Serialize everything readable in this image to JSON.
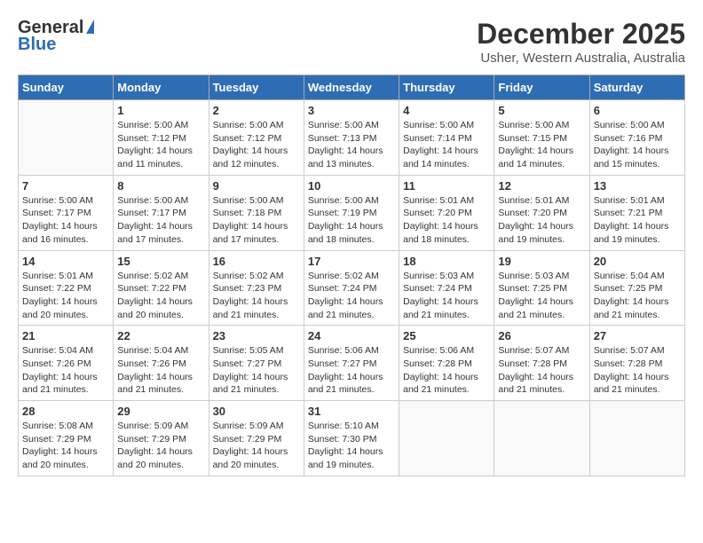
{
  "logo": {
    "general": "General",
    "blue": "Blue"
  },
  "title": "December 2025",
  "subtitle": "Usher, Western Australia, Australia",
  "days_of_week": [
    "Sunday",
    "Monday",
    "Tuesday",
    "Wednesday",
    "Thursday",
    "Friday",
    "Saturday"
  ],
  "weeks": [
    [
      {
        "day": "",
        "info": ""
      },
      {
        "day": "1",
        "info": "Sunrise: 5:00 AM\nSunset: 7:12 PM\nDaylight: 14 hours\nand 11 minutes."
      },
      {
        "day": "2",
        "info": "Sunrise: 5:00 AM\nSunset: 7:12 PM\nDaylight: 14 hours\nand 12 minutes."
      },
      {
        "day": "3",
        "info": "Sunrise: 5:00 AM\nSunset: 7:13 PM\nDaylight: 14 hours\nand 13 minutes."
      },
      {
        "day": "4",
        "info": "Sunrise: 5:00 AM\nSunset: 7:14 PM\nDaylight: 14 hours\nand 14 minutes."
      },
      {
        "day": "5",
        "info": "Sunrise: 5:00 AM\nSunset: 7:15 PM\nDaylight: 14 hours\nand 14 minutes."
      },
      {
        "day": "6",
        "info": "Sunrise: 5:00 AM\nSunset: 7:16 PM\nDaylight: 14 hours\nand 15 minutes."
      }
    ],
    [
      {
        "day": "7",
        "info": "Sunrise: 5:00 AM\nSunset: 7:17 PM\nDaylight: 14 hours\nand 16 minutes."
      },
      {
        "day": "8",
        "info": "Sunrise: 5:00 AM\nSunset: 7:17 PM\nDaylight: 14 hours\nand 17 minutes."
      },
      {
        "day": "9",
        "info": "Sunrise: 5:00 AM\nSunset: 7:18 PM\nDaylight: 14 hours\nand 17 minutes."
      },
      {
        "day": "10",
        "info": "Sunrise: 5:00 AM\nSunset: 7:19 PM\nDaylight: 14 hours\nand 18 minutes."
      },
      {
        "day": "11",
        "info": "Sunrise: 5:01 AM\nSunset: 7:20 PM\nDaylight: 14 hours\nand 18 minutes."
      },
      {
        "day": "12",
        "info": "Sunrise: 5:01 AM\nSunset: 7:20 PM\nDaylight: 14 hours\nand 19 minutes."
      },
      {
        "day": "13",
        "info": "Sunrise: 5:01 AM\nSunset: 7:21 PM\nDaylight: 14 hours\nand 19 minutes."
      }
    ],
    [
      {
        "day": "14",
        "info": "Sunrise: 5:01 AM\nSunset: 7:22 PM\nDaylight: 14 hours\nand 20 minutes."
      },
      {
        "day": "15",
        "info": "Sunrise: 5:02 AM\nSunset: 7:22 PM\nDaylight: 14 hours\nand 20 minutes."
      },
      {
        "day": "16",
        "info": "Sunrise: 5:02 AM\nSunset: 7:23 PM\nDaylight: 14 hours\nand 21 minutes."
      },
      {
        "day": "17",
        "info": "Sunrise: 5:02 AM\nSunset: 7:24 PM\nDaylight: 14 hours\nand 21 minutes."
      },
      {
        "day": "18",
        "info": "Sunrise: 5:03 AM\nSunset: 7:24 PM\nDaylight: 14 hours\nand 21 minutes."
      },
      {
        "day": "19",
        "info": "Sunrise: 5:03 AM\nSunset: 7:25 PM\nDaylight: 14 hours\nand 21 minutes."
      },
      {
        "day": "20",
        "info": "Sunrise: 5:04 AM\nSunset: 7:25 PM\nDaylight: 14 hours\nand 21 minutes."
      }
    ],
    [
      {
        "day": "21",
        "info": "Sunrise: 5:04 AM\nSunset: 7:26 PM\nDaylight: 14 hours\nand 21 minutes."
      },
      {
        "day": "22",
        "info": "Sunrise: 5:04 AM\nSunset: 7:26 PM\nDaylight: 14 hours\nand 21 minutes."
      },
      {
        "day": "23",
        "info": "Sunrise: 5:05 AM\nSunset: 7:27 PM\nDaylight: 14 hours\nand 21 minutes."
      },
      {
        "day": "24",
        "info": "Sunrise: 5:06 AM\nSunset: 7:27 PM\nDaylight: 14 hours\nand 21 minutes."
      },
      {
        "day": "25",
        "info": "Sunrise: 5:06 AM\nSunset: 7:28 PM\nDaylight: 14 hours\nand 21 minutes."
      },
      {
        "day": "26",
        "info": "Sunrise: 5:07 AM\nSunset: 7:28 PM\nDaylight: 14 hours\nand 21 minutes."
      },
      {
        "day": "27",
        "info": "Sunrise: 5:07 AM\nSunset: 7:28 PM\nDaylight: 14 hours\nand 21 minutes."
      }
    ],
    [
      {
        "day": "28",
        "info": "Sunrise: 5:08 AM\nSunset: 7:29 PM\nDaylight: 14 hours\nand 20 minutes."
      },
      {
        "day": "29",
        "info": "Sunrise: 5:09 AM\nSunset: 7:29 PM\nDaylight: 14 hours\nand 20 minutes."
      },
      {
        "day": "30",
        "info": "Sunrise: 5:09 AM\nSunset: 7:29 PM\nDaylight: 14 hours\nand 20 minutes."
      },
      {
        "day": "31",
        "info": "Sunrise: 5:10 AM\nSunset: 7:30 PM\nDaylight: 14 hours\nand 19 minutes."
      },
      {
        "day": "",
        "info": ""
      },
      {
        "day": "",
        "info": ""
      },
      {
        "day": "",
        "info": ""
      }
    ]
  ]
}
